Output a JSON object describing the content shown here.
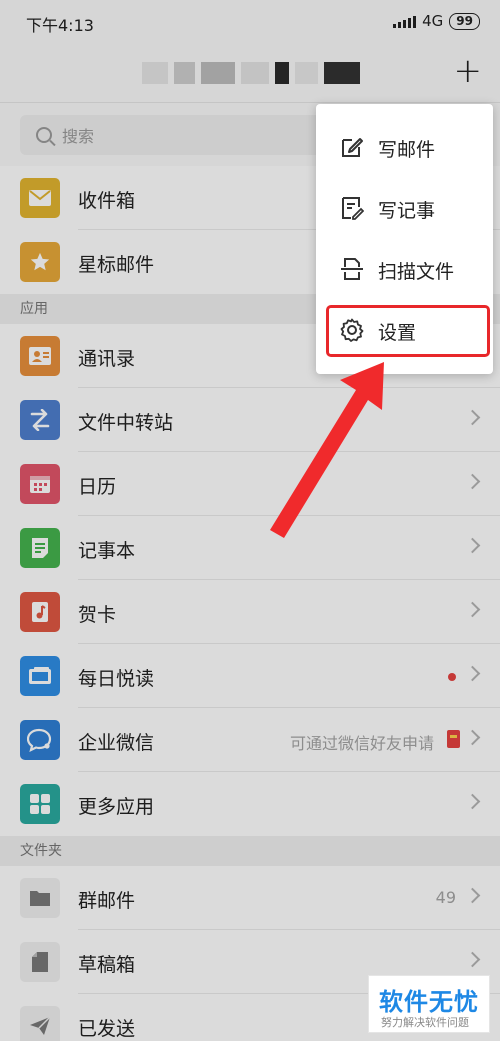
{
  "status_bar": {
    "time": "下午4:13",
    "network": "4G",
    "battery": "99"
  },
  "header": {
    "plus_label": "+"
  },
  "search": {
    "placeholder": "搜索"
  },
  "mail": [
    {
      "label": "收件箱",
      "icon": "envelope-icon",
      "color": "#e2b530"
    },
    {
      "label": "星标邮件",
      "icon": "star-icon",
      "color": "#e8a93a"
    }
  ],
  "apps_section": "应用",
  "apps": [
    {
      "label": "通讯录",
      "icon": "contacts-icon",
      "color": "#e8903c"
    },
    {
      "label": "文件中转站",
      "icon": "transfer-icon",
      "color": "#4e7fcf"
    },
    {
      "label": "日历",
      "icon": "calendar-icon",
      "color": "#e2566a"
    },
    {
      "label": "记事本",
      "icon": "notepad-icon",
      "color": "#45b44f"
    },
    {
      "label": "贺卡",
      "icon": "card-icon",
      "color": "#e05843"
    },
    {
      "label": "每日悦读",
      "icon": "reading-icon",
      "color": "#2f8fe6"
    },
    {
      "label": "企业微信",
      "icon": "wework-icon",
      "color": "#2f7fd6",
      "extra": "可通过微信好友申请"
    },
    {
      "label": "更多应用",
      "icon": "more-apps-icon",
      "color": "#2aaba0"
    }
  ],
  "folders_section": "文件夹",
  "folders": [
    {
      "label": "群邮件",
      "icon": "folder-icon",
      "count": "49"
    },
    {
      "label": "草稿箱",
      "icon": "draft-icon"
    },
    {
      "label": "已发送",
      "icon": "sent-icon"
    }
  ],
  "menu": [
    {
      "label": "写邮件",
      "icon": "compose-icon"
    },
    {
      "label": "写记事",
      "icon": "write-note-icon"
    },
    {
      "label": "扫描文件",
      "icon": "scan-icon"
    },
    {
      "label": "设置",
      "icon": "gear-icon"
    }
  ],
  "watermark": {
    "title": "软件无忧",
    "subtitle": "努力解决软件问题"
  },
  "colors": {
    "highlight": "#e8272a",
    "accent_blue": "#1e88e5"
  }
}
